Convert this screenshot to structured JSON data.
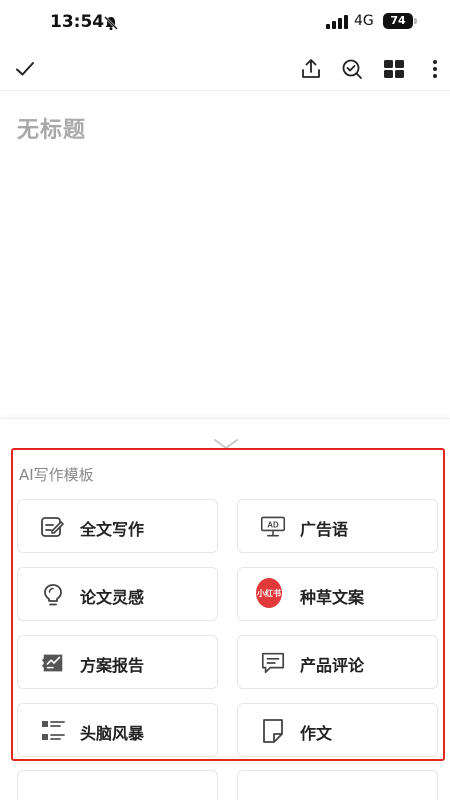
{
  "status_bar": {
    "time": "13:54",
    "network": "4G",
    "battery": "74"
  },
  "document": {
    "title": "无标题"
  },
  "ai_section": {
    "title": "AI写作模板",
    "templates": [
      {
        "label": "全文写作",
        "icon": "edit-document-icon"
      },
      {
        "label": "广告语",
        "icon": "ad-board-icon"
      },
      {
        "label": "论文灵感",
        "icon": "lightbulb-icon"
      },
      {
        "label": "种草文案",
        "icon": "xiaohongshu-logo",
        "badge": "小红书"
      },
      {
        "label": "方案报告",
        "icon": "report-icon"
      },
      {
        "label": "产品评论",
        "icon": "comment-icon"
      },
      {
        "label": "头脑风暴",
        "icon": "brainstorm-list-icon"
      },
      {
        "label": "作文",
        "icon": "essay-page-icon"
      }
    ]
  },
  "colors": {
    "highlight": "#e0261d",
    "badge": "#e2393b",
    "placeholder": "#a9a9a9"
  }
}
